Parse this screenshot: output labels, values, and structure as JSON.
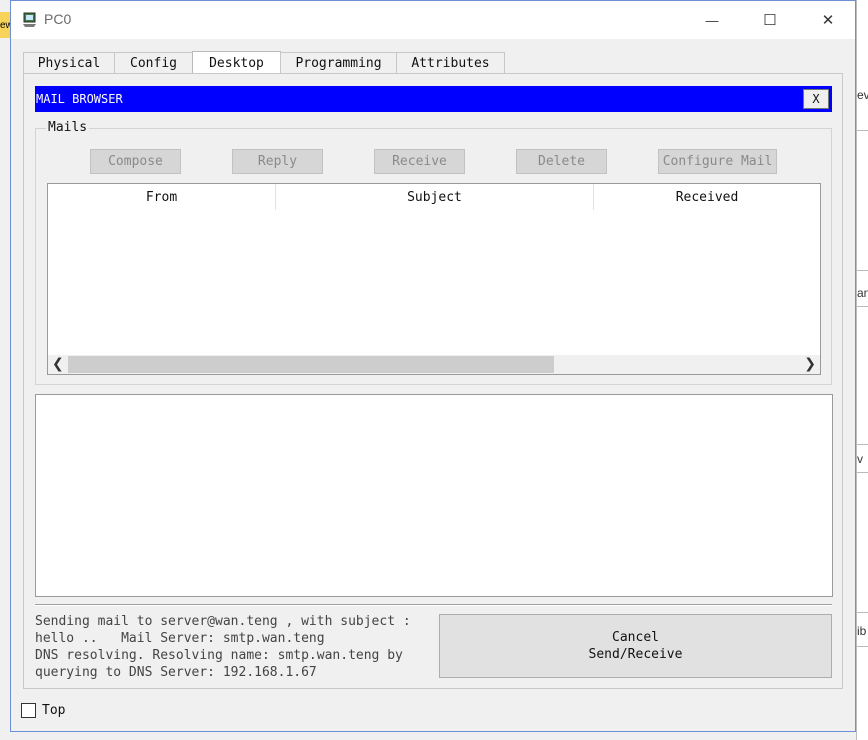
{
  "window": {
    "title": "PC0",
    "controls": {
      "minimize": "—",
      "maximize": "☐",
      "close": "✕"
    }
  },
  "tabs": [
    {
      "label": "Physical"
    },
    {
      "label": "Config"
    },
    {
      "label": "Desktop",
      "active": true
    },
    {
      "label": "Programming"
    },
    {
      "label": "Attributes"
    }
  ],
  "mail_browser": {
    "title": "MAIL BROWSER",
    "close_label": "X",
    "group_label": "Mails",
    "buttons": {
      "compose": "Compose",
      "reply": "Reply",
      "receive": "Receive",
      "delete": "Delete",
      "configure": "Configure Mail"
    },
    "table": {
      "columns": [
        "From",
        "Subject",
        "Received"
      ]
    },
    "status": "Sending mail to server@wan.teng , with subject : hello ..   Mail Server: smtp.wan.teng\nDNS resolving. Resolving name: smtp.wan.teng by querying to DNS Server: 192.168.1.67",
    "cancel_line1": "Cancel",
    "cancel_line2": "Send/Receive"
  },
  "top_checkbox_label": "Top",
  "background": {
    "sliver_1": "ew",
    "sliver_2": "ev",
    "sliver_3": "an",
    "sliver_4": "v",
    "sliver_5": "ib"
  },
  "colors": {
    "browser_bar": "#0000ff",
    "window_border": "#6b8fd8"
  }
}
